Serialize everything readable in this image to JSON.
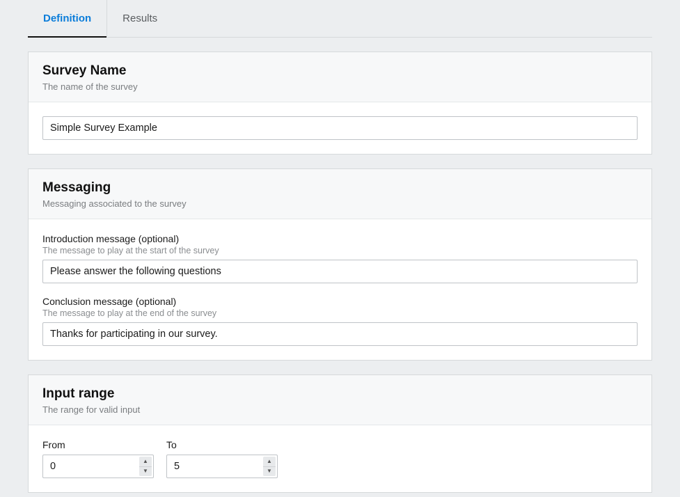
{
  "tabs": {
    "definition": "Definition",
    "results": "Results"
  },
  "surveyName": {
    "title": "Survey Name",
    "subtitle": "The name of the survey",
    "value": "Simple Survey Example"
  },
  "messaging": {
    "title": "Messaging",
    "subtitle": "Messaging associated to the survey",
    "intro": {
      "label": "Introduction message (optional)",
      "hint": "The message to play at the start of the survey",
      "value": "Please answer the following questions"
    },
    "conclusion": {
      "label": "Conclusion message (optional)",
      "hint": "The message to play at the end of the survey",
      "value": "Thanks for participating in our survey."
    }
  },
  "inputRange": {
    "title": "Input range",
    "subtitle": "The range for valid input",
    "fromLabel": "From",
    "fromValue": "0",
    "toLabel": "To",
    "toValue": "5"
  }
}
